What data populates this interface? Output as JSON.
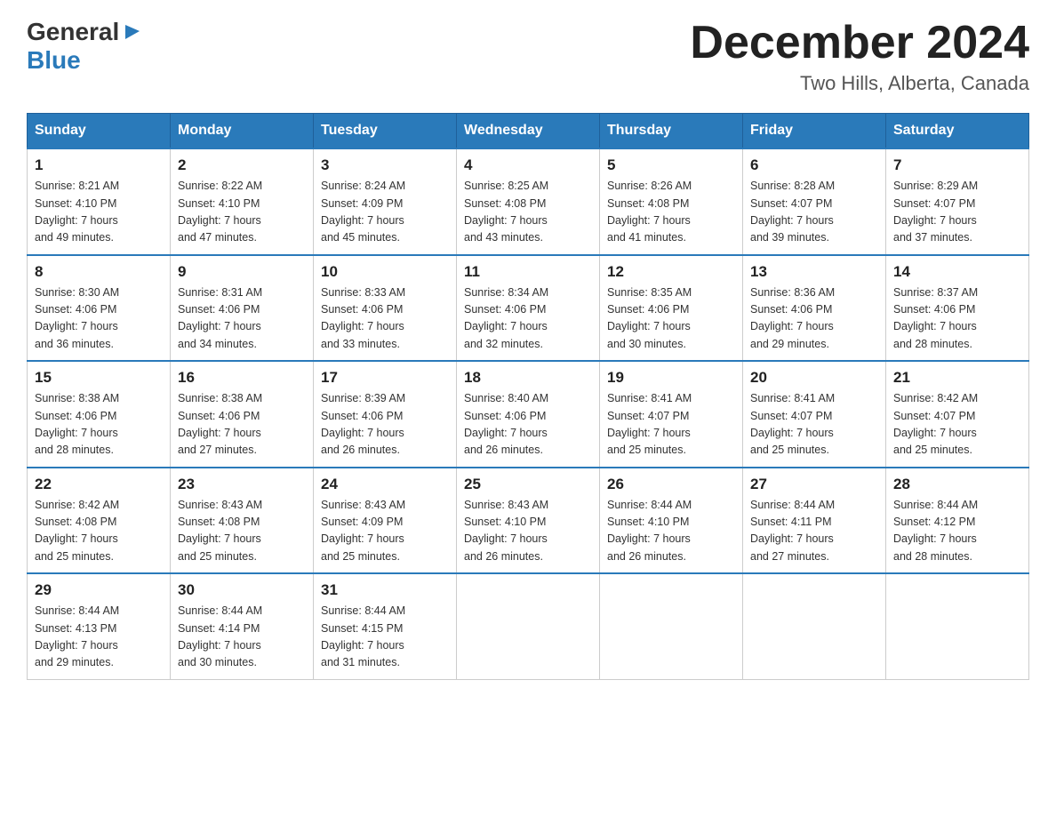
{
  "logo": {
    "general": "General",
    "blue": "Blue",
    "arrow": "▶"
  },
  "title": "December 2024",
  "subtitle": "Two Hills, Alberta, Canada",
  "days_of_week": [
    "Sunday",
    "Monday",
    "Tuesday",
    "Wednesday",
    "Thursday",
    "Friday",
    "Saturday"
  ],
  "weeks": [
    [
      {
        "day": "1",
        "sunrise": "8:21 AM",
        "sunset": "4:10 PM",
        "daylight": "7 hours and 49 minutes."
      },
      {
        "day": "2",
        "sunrise": "8:22 AM",
        "sunset": "4:10 PM",
        "daylight": "7 hours and 47 minutes."
      },
      {
        "day": "3",
        "sunrise": "8:24 AM",
        "sunset": "4:09 PM",
        "daylight": "7 hours and 45 minutes."
      },
      {
        "day": "4",
        "sunrise": "8:25 AM",
        "sunset": "4:08 PM",
        "daylight": "7 hours and 43 minutes."
      },
      {
        "day": "5",
        "sunrise": "8:26 AM",
        "sunset": "4:08 PM",
        "daylight": "7 hours and 41 minutes."
      },
      {
        "day": "6",
        "sunrise": "8:28 AM",
        "sunset": "4:07 PM",
        "daylight": "7 hours and 39 minutes."
      },
      {
        "day": "7",
        "sunrise": "8:29 AM",
        "sunset": "4:07 PM",
        "daylight": "7 hours and 37 minutes."
      }
    ],
    [
      {
        "day": "8",
        "sunrise": "8:30 AM",
        "sunset": "4:06 PM",
        "daylight": "7 hours and 36 minutes."
      },
      {
        "day": "9",
        "sunrise": "8:31 AM",
        "sunset": "4:06 PM",
        "daylight": "7 hours and 34 minutes."
      },
      {
        "day": "10",
        "sunrise": "8:33 AM",
        "sunset": "4:06 PM",
        "daylight": "7 hours and 33 minutes."
      },
      {
        "day": "11",
        "sunrise": "8:34 AM",
        "sunset": "4:06 PM",
        "daylight": "7 hours and 32 minutes."
      },
      {
        "day": "12",
        "sunrise": "8:35 AM",
        "sunset": "4:06 PM",
        "daylight": "7 hours and 30 minutes."
      },
      {
        "day": "13",
        "sunrise": "8:36 AM",
        "sunset": "4:06 PM",
        "daylight": "7 hours and 29 minutes."
      },
      {
        "day": "14",
        "sunrise": "8:37 AM",
        "sunset": "4:06 PM",
        "daylight": "7 hours and 28 minutes."
      }
    ],
    [
      {
        "day": "15",
        "sunrise": "8:38 AM",
        "sunset": "4:06 PM",
        "daylight": "7 hours and 28 minutes."
      },
      {
        "day": "16",
        "sunrise": "8:38 AM",
        "sunset": "4:06 PM",
        "daylight": "7 hours and 27 minutes."
      },
      {
        "day": "17",
        "sunrise": "8:39 AM",
        "sunset": "4:06 PM",
        "daylight": "7 hours and 26 minutes."
      },
      {
        "day": "18",
        "sunrise": "8:40 AM",
        "sunset": "4:06 PM",
        "daylight": "7 hours and 26 minutes."
      },
      {
        "day": "19",
        "sunrise": "8:41 AM",
        "sunset": "4:07 PM",
        "daylight": "7 hours and 25 minutes."
      },
      {
        "day": "20",
        "sunrise": "8:41 AM",
        "sunset": "4:07 PM",
        "daylight": "7 hours and 25 minutes."
      },
      {
        "day": "21",
        "sunrise": "8:42 AM",
        "sunset": "4:07 PM",
        "daylight": "7 hours and 25 minutes."
      }
    ],
    [
      {
        "day": "22",
        "sunrise": "8:42 AM",
        "sunset": "4:08 PM",
        "daylight": "7 hours and 25 minutes."
      },
      {
        "day": "23",
        "sunrise": "8:43 AM",
        "sunset": "4:08 PM",
        "daylight": "7 hours and 25 minutes."
      },
      {
        "day": "24",
        "sunrise": "8:43 AM",
        "sunset": "4:09 PM",
        "daylight": "7 hours and 25 minutes."
      },
      {
        "day": "25",
        "sunrise": "8:43 AM",
        "sunset": "4:10 PM",
        "daylight": "7 hours and 26 minutes."
      },
      {
        "day": "26",
        "sunrise": "8:44 AM",
        "sunset": "4:10 PM",
        "daylight": "7 hours and 26 minutes."
      },
      {
        "day": "27",
        "sunrise": "8:44 AM",
        "sunset": "4:11 PM",
        "daylight": "7 hours and 27 minutes."
      },
      {
        "day": "28",
        "sunrise": "8:44 AM",
        "sunset": "4:12 PM",
        "daylight": "7 hours and 28 minutes."
      }
    ],
    [
      {
        "day": "29",
        "sunrise": "8:44 AM",
        "sunset": "4:13 PM",
        "daylight": "7 hours and 29 minutes."
      },
      {
        "day": "30",
        "sunrise": "8:44 AM",
        "sunset": "4:14 PM",
        "daylight": "7 hours and 30 minutes."
      },
      {
        "day": "31",
        "sunrise": "8:44 AM",
        "sunset": "4:15 PM",
        "daylight": "7 hours and 31 minutes."
      },
      null,
      null,
      null,
      null
    ]
  ],
  "labels": {
    "sunrise": "Sunrise: ",
    "sunset": "Sunset: ",
    "daylight": "Daylight: "
  }
}
